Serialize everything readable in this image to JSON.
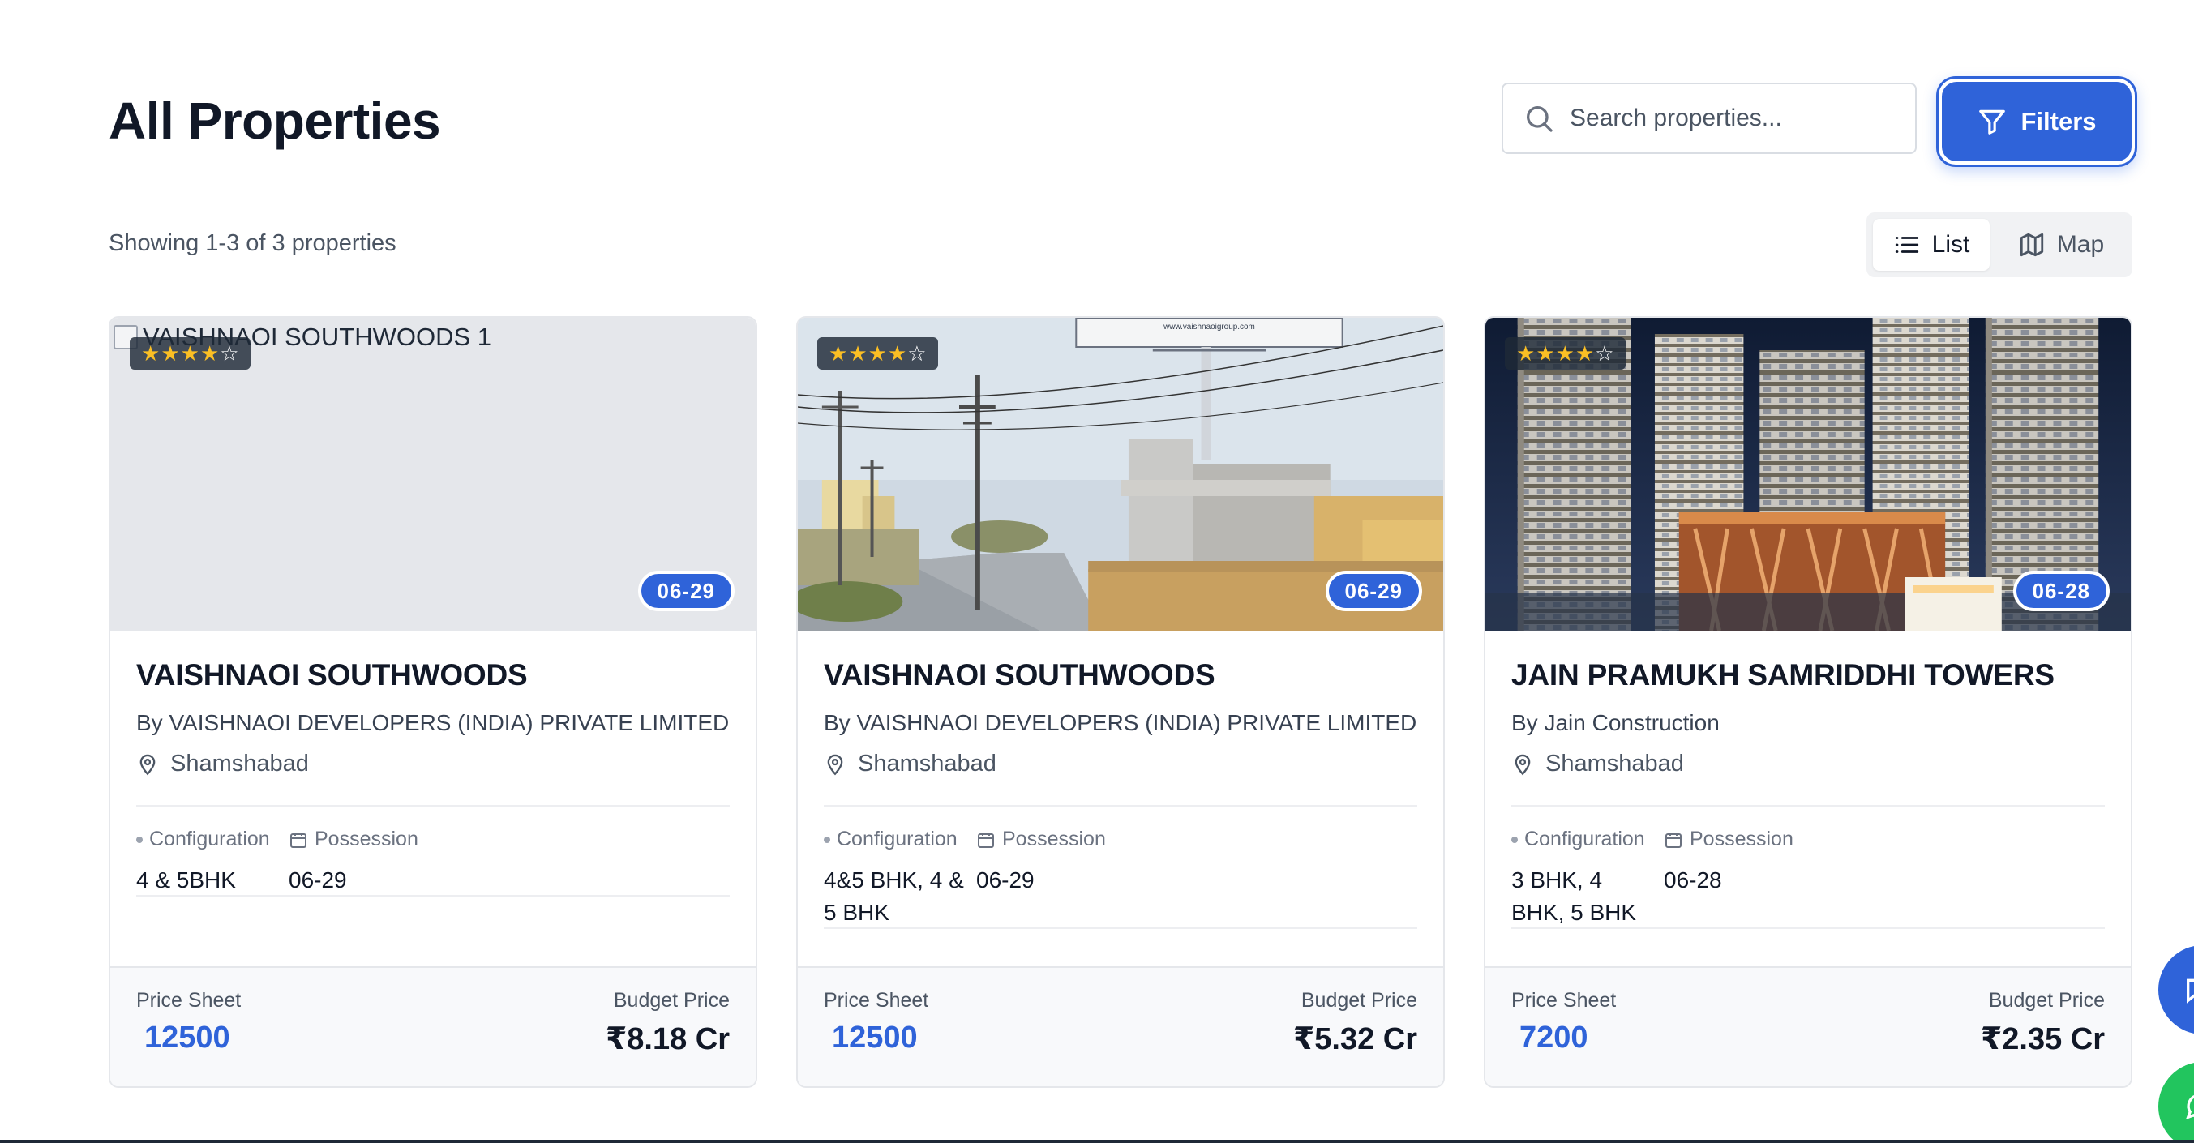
{
  "header": {
    "title": "All Properties",
    "search_placeholder": "Search properties...",
    "filters_label": "Filters"
  },
  "results": {
    "showing_text": "Showing 1-3 of 3 properties"
  },
  "view_toggle": {
    "list_label": "List",
    "map_label": "Map",
    "active": "List"
  },
  "labels": {
    "configuration": "Configuration",
    "possession": "Possession",
    "price_sheet": "Price Sheet",
    "budget_price": "Budget Price"
  },
  "properties": [
    {
      "image_alt": "VAISHNAOI SOUTHWOODS 1",
      "rating": 4,
      "rating_max": 5,
      "date_badge": "06-29",
      "name": "VAISHNAOI SOUTHWOODS",
      "developer": "By VAISHNAOI DEVELOPERS (INDIA) PRIVATE LIMITED",
      "location": "Shamshabad",
      "configuration": "4 & 5BHK",
      "possession": "06-29",
      "price_sheet": "12500",
      "budget_price": "₹8.18 Cr"
    },
    {
      "image_alt": "",
      "billboard_text": "www.vaishnaoigroup.com",
      "rating": 4,
      "rating_max": 5,
      "date_badge": "06-29",
      "name": "VAISHNAOI SOUTHWOODS",
      "developer": "By VAISHNAOI DEVELOPERS (INDIA) PRIVATE LIMITED",
      "location": "Shamshabad",
      "configuration": "4&5 BHK, 4 & 5 BHK",
      "possession": "06-29",
      "price_sheet": "12500",
      "budget_price": "₹5.32 Cr"
    },
    {
      "image_alt": "",
      "rating": 4,
      "rating_max": 5,
      "date_badge": "06-28",
      "name": "JAIN PRAMUKH SAMRIDDHI TOWERS",
      "developer": "By Jain Construction",
      "location": "Shamshabad",
      "configuration": "3 BHK, 4 BHK, 5 BHK",
      "possession": "06-28",
      "price_sheet": "7200",
      "budget_price": "₹2.35 Cr"
    }
  ],
  "icons": {
    "search": "search-icon",
    "filter": "filter-icon",
    "list": "list-icon",
    "map": "map-icon",
    "location": "map-pin-icon",
    "calendar": "calendar-icon"
  },
  "colors": {
    "primary": "#2f63d9",
    "whatsapp": "#22c55e",
    "star": "#fbbf24"
  }
}
